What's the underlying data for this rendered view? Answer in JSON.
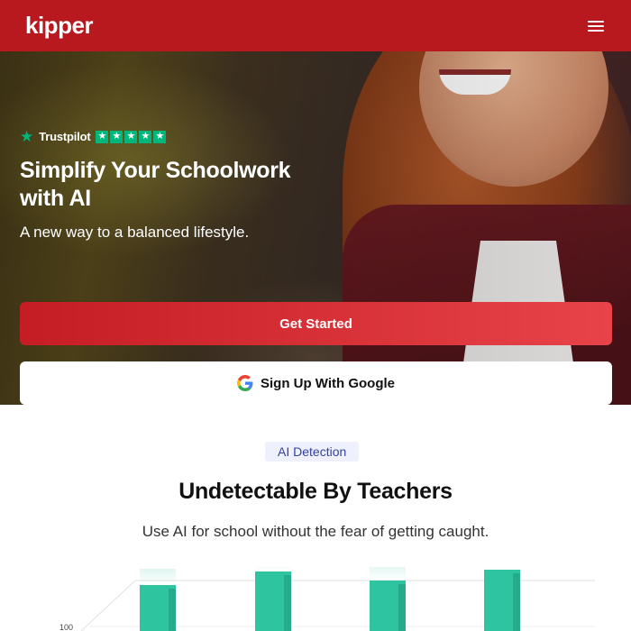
{
  "header": {
    "logo": "kipper",
    "menu_icon": "hamburger-icon"
  },
  "hero": {
    "trustpilot": {
      "name": "Trustpilot",
      "stars": 5
    },
    "title": "Simplify Your Schoolwork with AI",
    "subtitle": "A new way to a balanced lifestyle.",
    "primary_button": "Get Started",
    "google_button": "Sign Up With Google"
  },
  "section": {
    "badge": "AI Detection",
    "title": "Undetectable By Teachers",
    "subtitle": "Use AI for school without the fear of getting caught."
  },
  "chart_data": {
    "type": "bar",
    "y_tick_visible": "100",
    "values": [
      100,
      100,
      100,
      100
    ],
    "bar_color": "#2ec4a0"
  },
  "colors": {
    "brand_red": "#b8191f",
    "trustpilot_green": "#00b67a",
    "badge_text": "#3342a0"
  }
}
